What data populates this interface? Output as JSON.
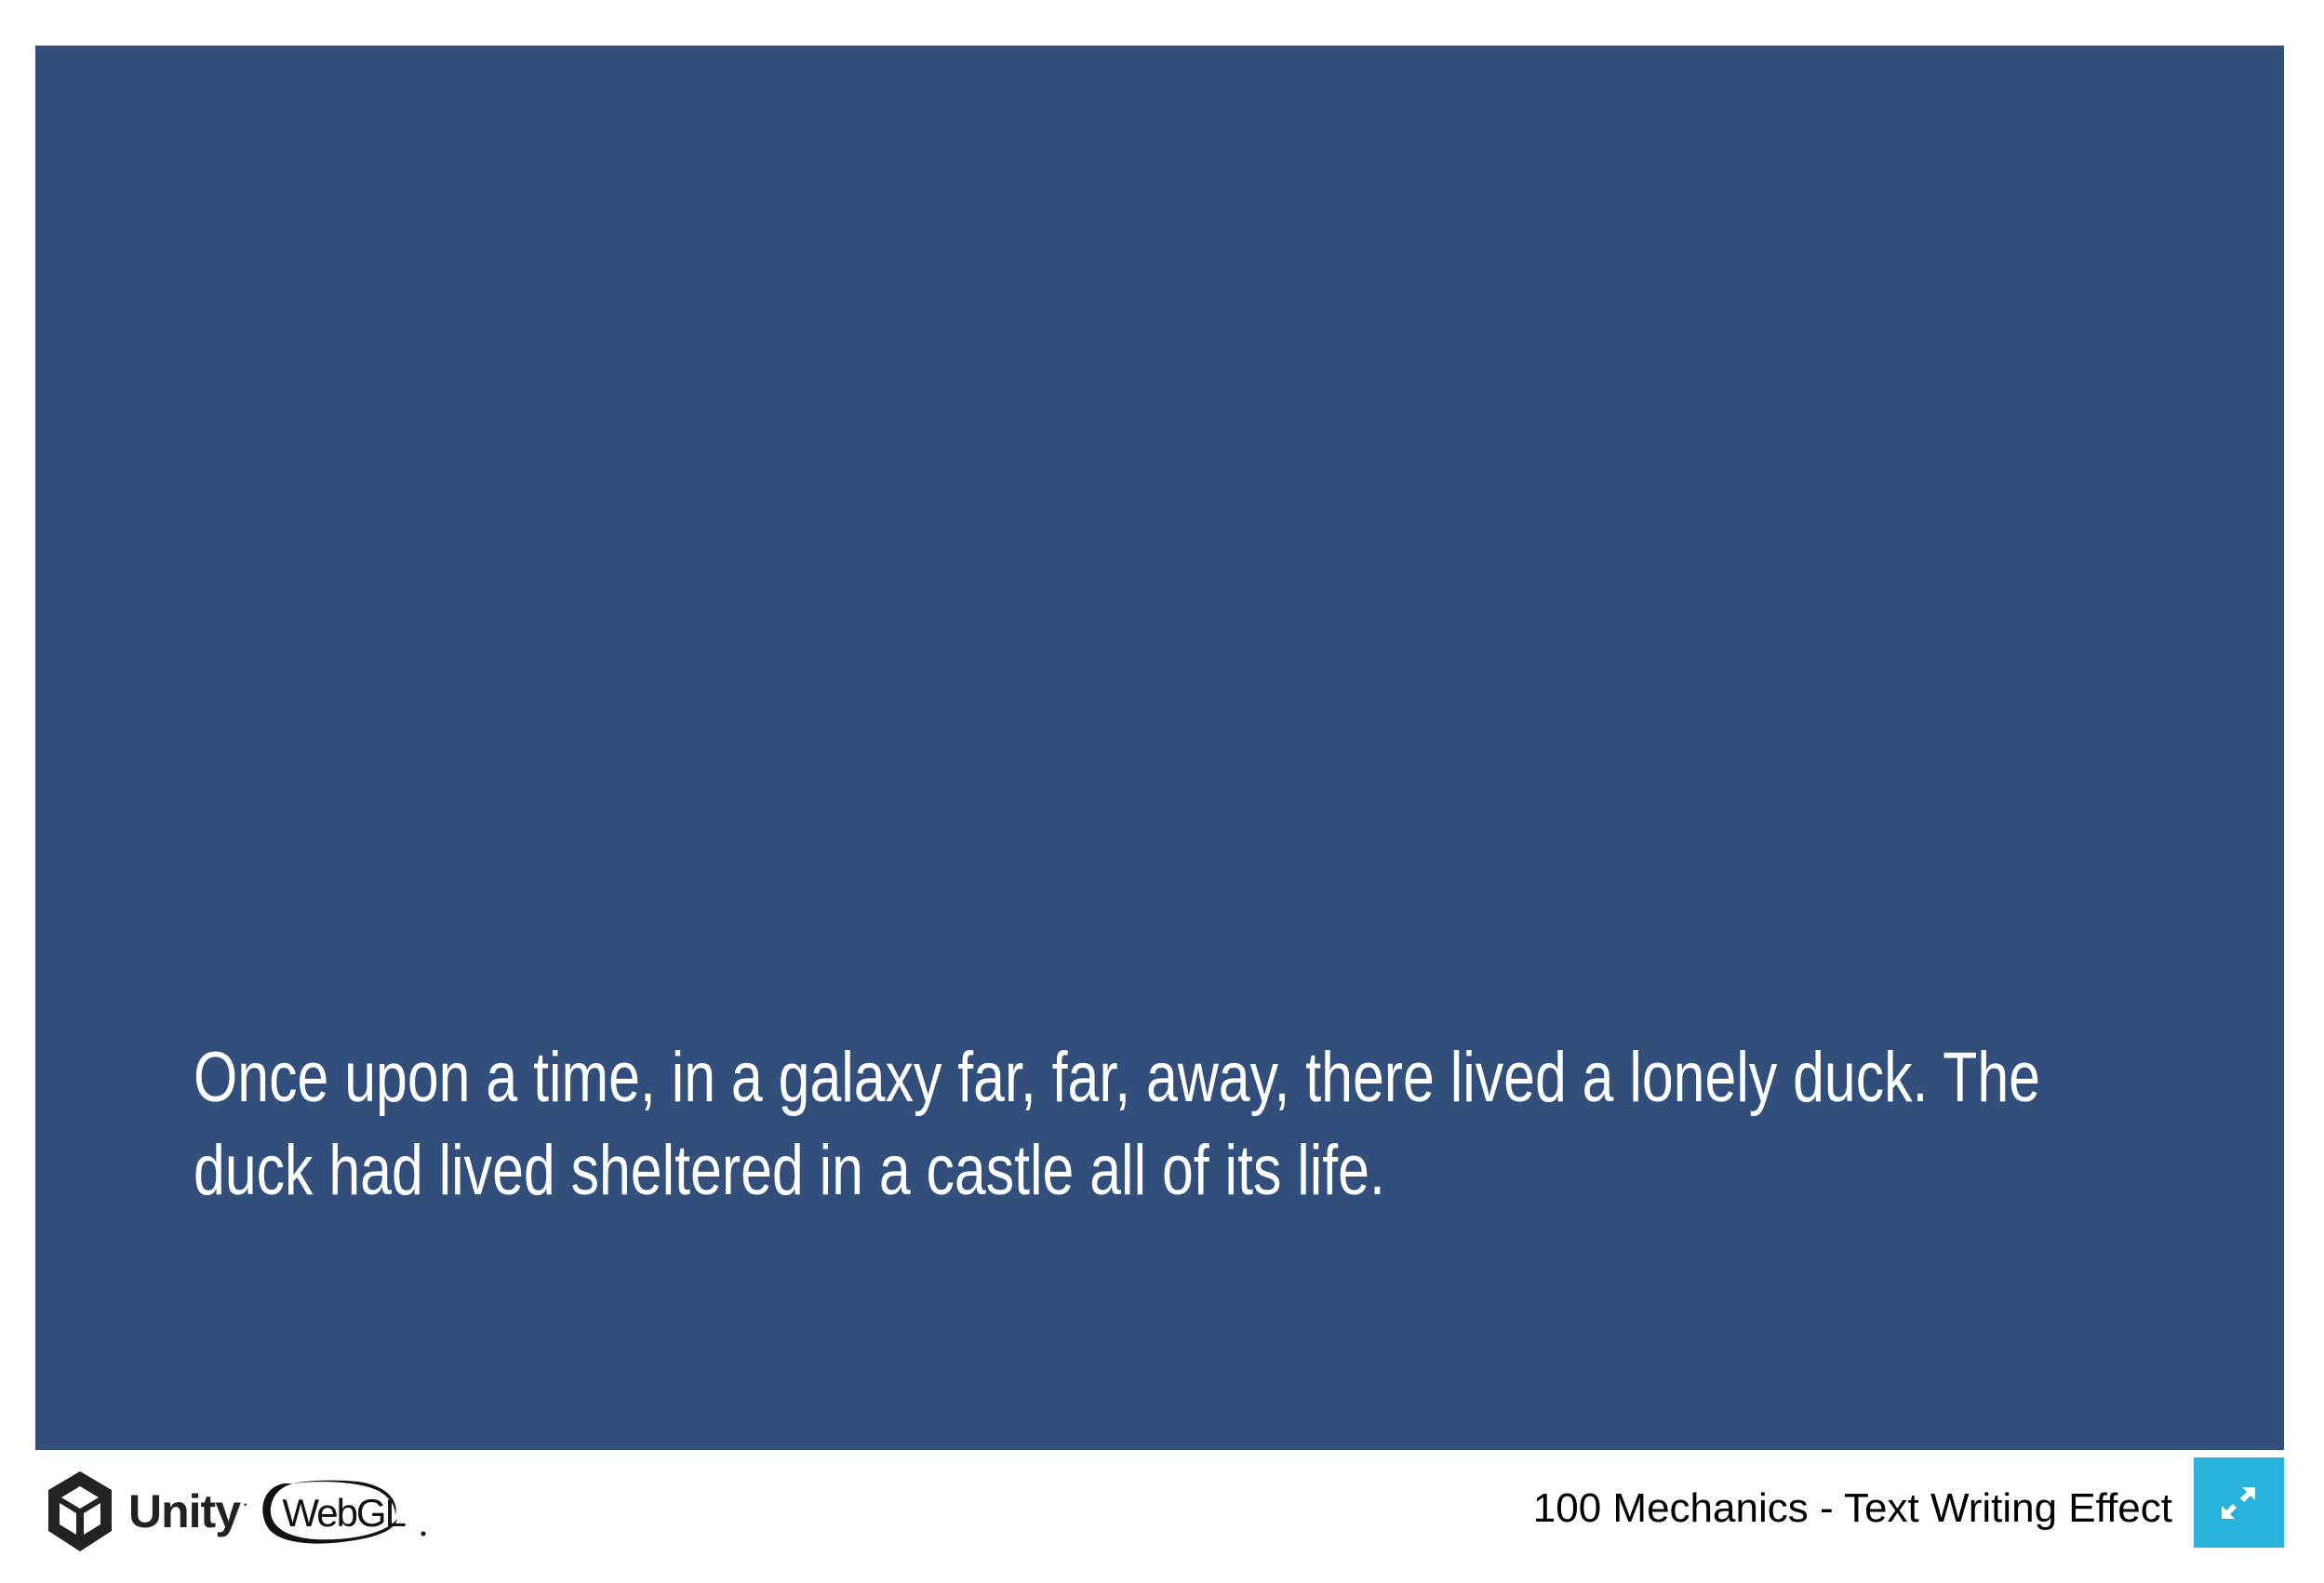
{
  "game": {
    "background_color": "#324f7b",
    "text_color": "#ffffff",
    "story_text": "Once upon a time, in a galaxy far, far, away, there lived a lonely duck. The duck had lived sheltered in a castle all of its life."
  },
  "footer": {
    "unity_label": "Unity",
    "unity_dot": "·",
    "webgl_label": "WebGL",
    "build_title": "100 Mechanics - Text Writing Effect",
    "fullscreen_icon": "expand-arrows-icon",
    "fullscreen_color": "#27b3db"
  }
}
